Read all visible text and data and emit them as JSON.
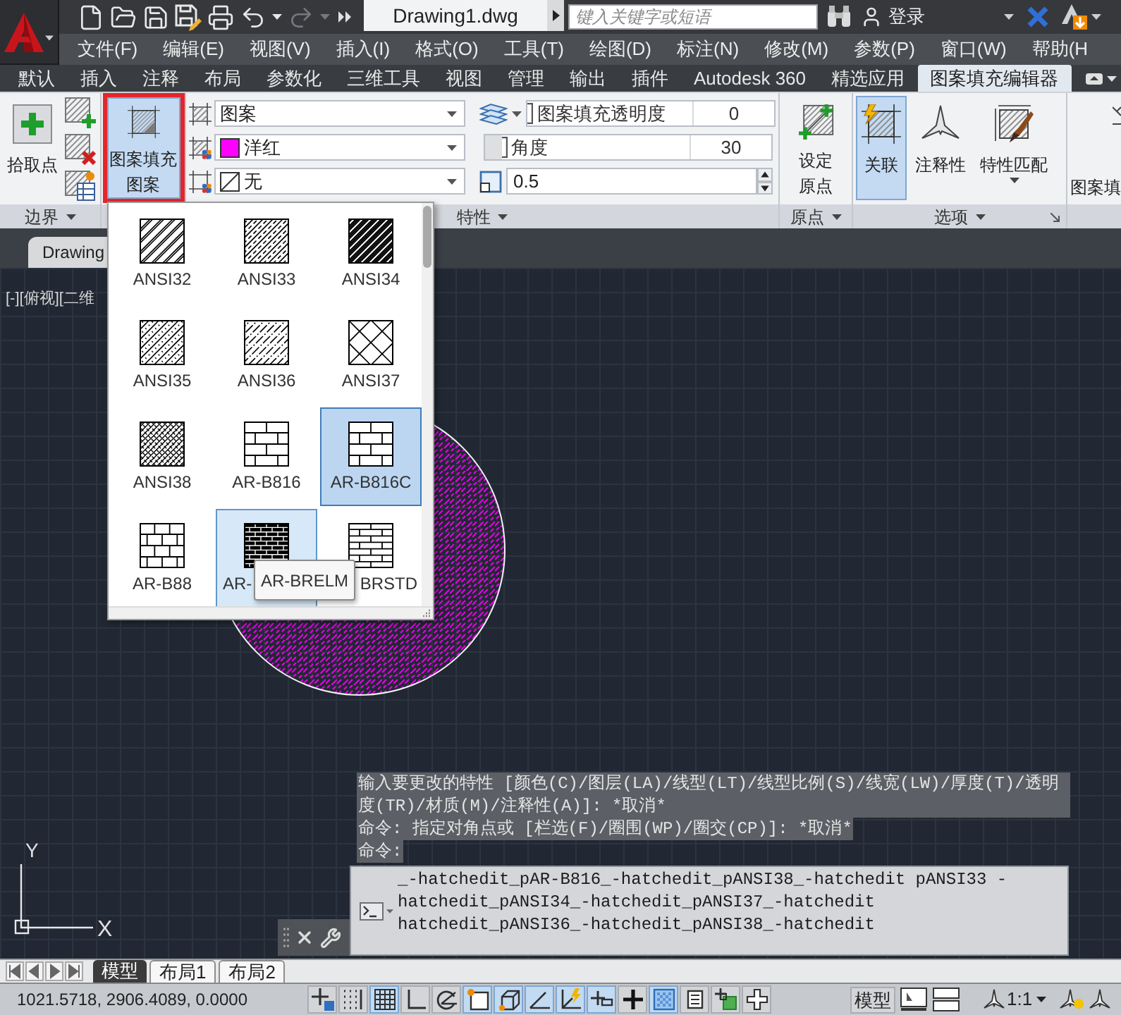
{
  "title_bar": {
    "quick_access": [
      {
        "kind": "new",
        "disabled": false
      },
      {
        "kind": "open",
        "disabled": false
      },
      {
        "kind": "save",
        "disabled": false
      },
      {
        "kind": "save-as",
        "disabled": false
      },
      {
        "kind": "print",
        "disabled": false
      },
      {
        "kind": "undo",
        "disabled": false
      },
      {
        "kind": "redo",
        "disabled": true
      }
    ],
    "document_tab": "Drawing1.dwg",
    "search": {
      "placeholder": "键入关键字或短语"
    },
    "sign_in": "登录"
  },
  "menu_bar": [
    "文件(F)",
    "编辑(E)",
    "视图(V)",
    "插入(I)",
    "格式(O)",
    "工具(T)",
    "绘图(D)",
    "标注(N)",
    "修改(M)",
    "参数(P)",
    "窗口(W)",
    "帮助(H"
  ],
  "ribbon_tabs": [
    {
      "label": "默认",
      "selected": false
    },
    {
      "label": "插入",
      "selected": false
    },
    {
      "label": "注释",
      "selected": false
    },
    {
      "label": "布局",
      "selected": false
    },
    {
      "label": "参数化",
      "selected": false
    },
    {
      "label": "三维工具",
      "selected": false
    },
    {
      "label": "视图",
      "selected": false
    },
    {
      "label": "管理",
      "selected": false
    },
    {
      "label": "输出",
      "selected": false
    },
    {
      "label": "插件",
      "selected": false
    },
    {
      "label": "Autodesk 360",
      "selected": false
    },
    {
      "label": "精选应用",
      "selected": false
    },
    {
      "label": "图案填充编辑器",
      "selected": true
    }
  ],
  "ribbon": {
    "boundary_panel": {
      "title": "边界",
      "button": "拾取点"
    },
    "pattern_panel": {
      "button": "图案填充图案",
      "selected": true,
      "outlined": true
    },
    "properties_panel": {
      "title": "特性",
      "hatch_type": "图案",
      "hatch_color": "洋红",
      "background_color": "无",
      "transparency": {
        "label": "图案填充透明度",
        "value": "0",
        "level": 0
      },
      "angle": {
        "label": "角度",
        "value": "30",
        "level": 0.08
      },
      "scale": "0.5"
    },
    "origin_panel": {
      "title": "原点",
      "button": "设定原点"
    },
    "options_panel": {
      "title": "选项",
      "buttons": [
        {
          "kind": "associative",
          "label": "关联",
          "selected": true
        },
        {
          "kind": "annotative",
          "label": "注释性",
          "selected": false
        },
        {
          "kind": "match",
          "label": "特性匹配",
          "selected": false
        }
      ]
    },
    "close_panel": {
      "button": "图案填"
    }
  },
  "file_tab": "Drawing",
  "viewport_label": "[-][俯视][二维",
  "pattern_gallery": {
    "items": [
      {
        "label": "ANSI32",
        "kind": "double-lines",
        "selected": false,
        "hovered": false
      },
      {
        "label": "ANSI33",
        "kind": "dash-lines",
        "selected": false,
        "hovered": false
      },
      {
        "label": "ANSI34",
        "kind": "dense-lines",
        "selected": false,
        "hovered": false
      },
      {
        "label": "ANSI35",
        "kind": "dot-lines",
        "selected": false,
        "hovered": false
      },
      {
        "label": "ANSI36",
        "kind": "broken-lines",
        "selected": false,
        "hovered": false
      },
      {
        "label": "ANSI37",
        "kind": "cross-lines",
        "selected": false,
        "hovered": false
      },
      {
        "label": "ANSI38",
        "kind": "dense-cross",
        "selected": false,
        "hovered": false
      },
      {
        "label": "AR-B816",
        "kind": "brick",
        "selected": false,
        "hovered": false
      },
      {
        "label": "AR-B816C",
        "kind": "brick",
        "selected": true,
        "hovered": false
      },
      {
        "label": "AR-B88",
        "kind": "brick-square",
        "selected": false,
        "hovered": false
      },
      {
        "label": "AR-",
        "kind": "brick-fine",
        "selected": false,
        "hovered": true
      },
      {
        "label": "BRSTD",
        "kind": "brick-thin",
        "selected": false,
        "hovered": false
      }
    ],
    "tooltip": "AR-BRELM"
  },
  "command_history": [
    "输入要更改的特性 [颜色(C)/图层(LA)/线型(LT)/线型比例(S)/线宽(LW)/厚度(T)/透明度(TR)/材质(M)/注释性(A)]: *取消*",
    "命令: 指定对角点或 [栏选(F)/圈围(WP)/圈交(CP)]: *取消*",
    "命令:"
  ],
  "command_line": {
    "lines": [
      "_-hatchedit_pAR-B816_-hatchedit_pANSI38_-hatchedit pANSI33 -",
      "hatchedit_pANSI34_-hatchedit_pANSI37_-hatchedit",
      "hatchedit_pANSI36_-hatchedit_pANSI38_-hatchedit"
    ]
  },
  "ucs_icon": {
    "x_label": "X",
    "y_label": "Y"
  },
  "layout_tabs": [
    {
      "label": "模型",
      "selected": true
    },
    {
      "label": "布局1",
      "selected": false
    },
    {
      "label": "布局2",
      "selected": false
    }
  ],
  "status_bar": {
    "coordinates": "1021.5718, 2906.4089, 0.0000",
    "toggles": [
      {
        "kind": "infer",
        "selected": false
      },
      {
        "kind": "snap",
        "selected": false
      },
      {
        "kind": "grid",
        "selected": true
      },
      {
        "kind": "ortho",
        "selected": false
      },
      {
        "kind": "polar",
        "selected": false
      },
      {
        "kind": "osnap",
        "selected": true
      },
      {
        "kind": "osnap3d",
        "selected": true
      },
      {
        "kind": "otrack",
        "selected": true
      },
      {
        "kind": "ducs",
        "selected": true
      },
      {
        "kind": "dyn",
        "selected": true
      },
      {
        "kind": "lineweight",
        "selected": false
      },
      {
        "kind": "transparency",
        "selected": true
      },
      {
        "kind": "quickprops",
        "selected": false
      },
      {
        "kind": "selcycle",
        "selected": false
      },
      {
        "kind": "annomonitor",
        "selected": false
      }
    ],
    "model_button": "模型",
    "annotation_scale": "1:1"
  }
}
